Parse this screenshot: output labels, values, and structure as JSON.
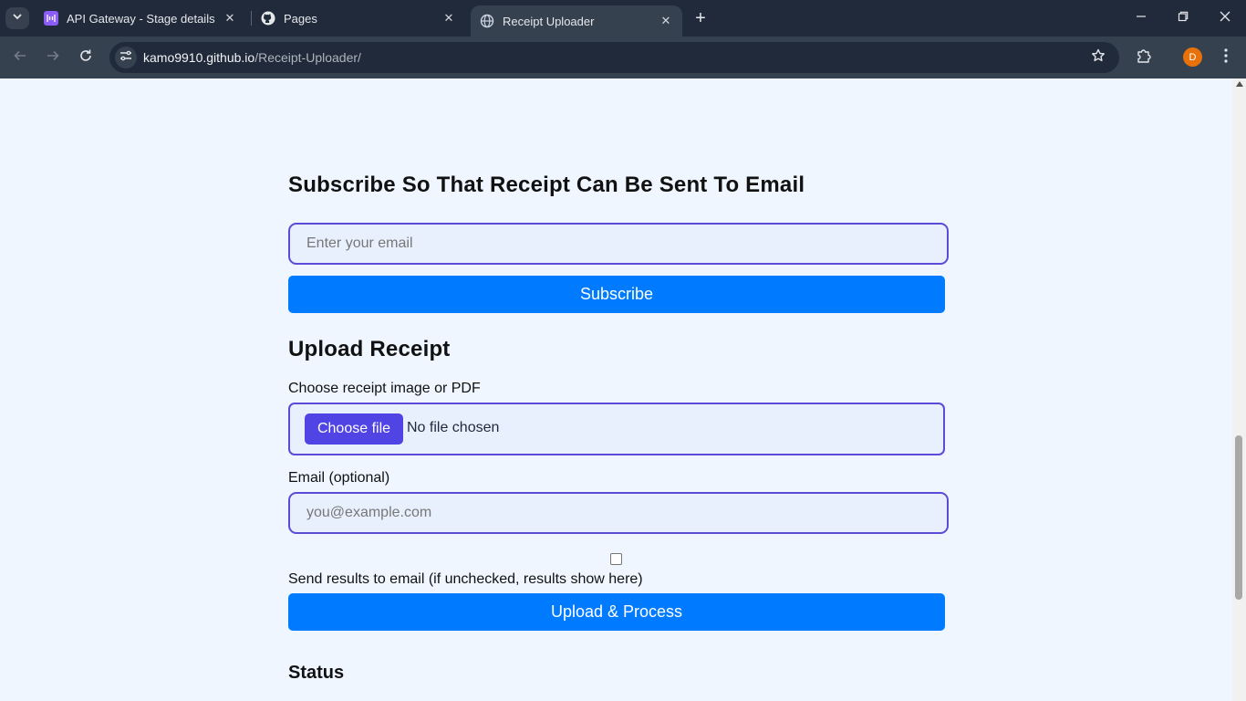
{
  "browser": {
    "tabs": [
      {
        "title": "API Gateway - Stage details",
        "icon": "api-gateway-icon",
        "active": false
      },
      {
        "title": "Pages",
        "icon": "github-icon",
        "active": false
      },
      {
        "title": "Receipt Uploader",
        "icon": "globe-icon",
        "active": true
      }
    ],
    "url_host": "kamo9910.github.io",
    "url_path": "/Receipt-Uploader/",
    "profile_initial": "D"
  },
  "subscribe": {
    "heading": "Subscribe So That Receipt Can Be Sent To Email",
    "email_placeholder": "Enter your email",
    "button_label": "Subscribe"
  },
  "upload": {
    "heading": "Upload Receipt",
    "file_label": "Choose receipt image or PDF",
    "choose_button": "Choose file",
    "file_status": "No file chosen",
    "email_label": "Email (optional)",
    "email_placeholder": "you@example.com",
    "send_email_label": "Send results to email (if unchecked, results show here)",
    "button_label": "Upload & Process"
  },
  "status": {
    "heading": "Status"
  },
  "colors": {
    "primary_button": "#007bff",
    "accent_border": "#5b4bd6",
    "page_bg": "#eff6ff"
  }
}
